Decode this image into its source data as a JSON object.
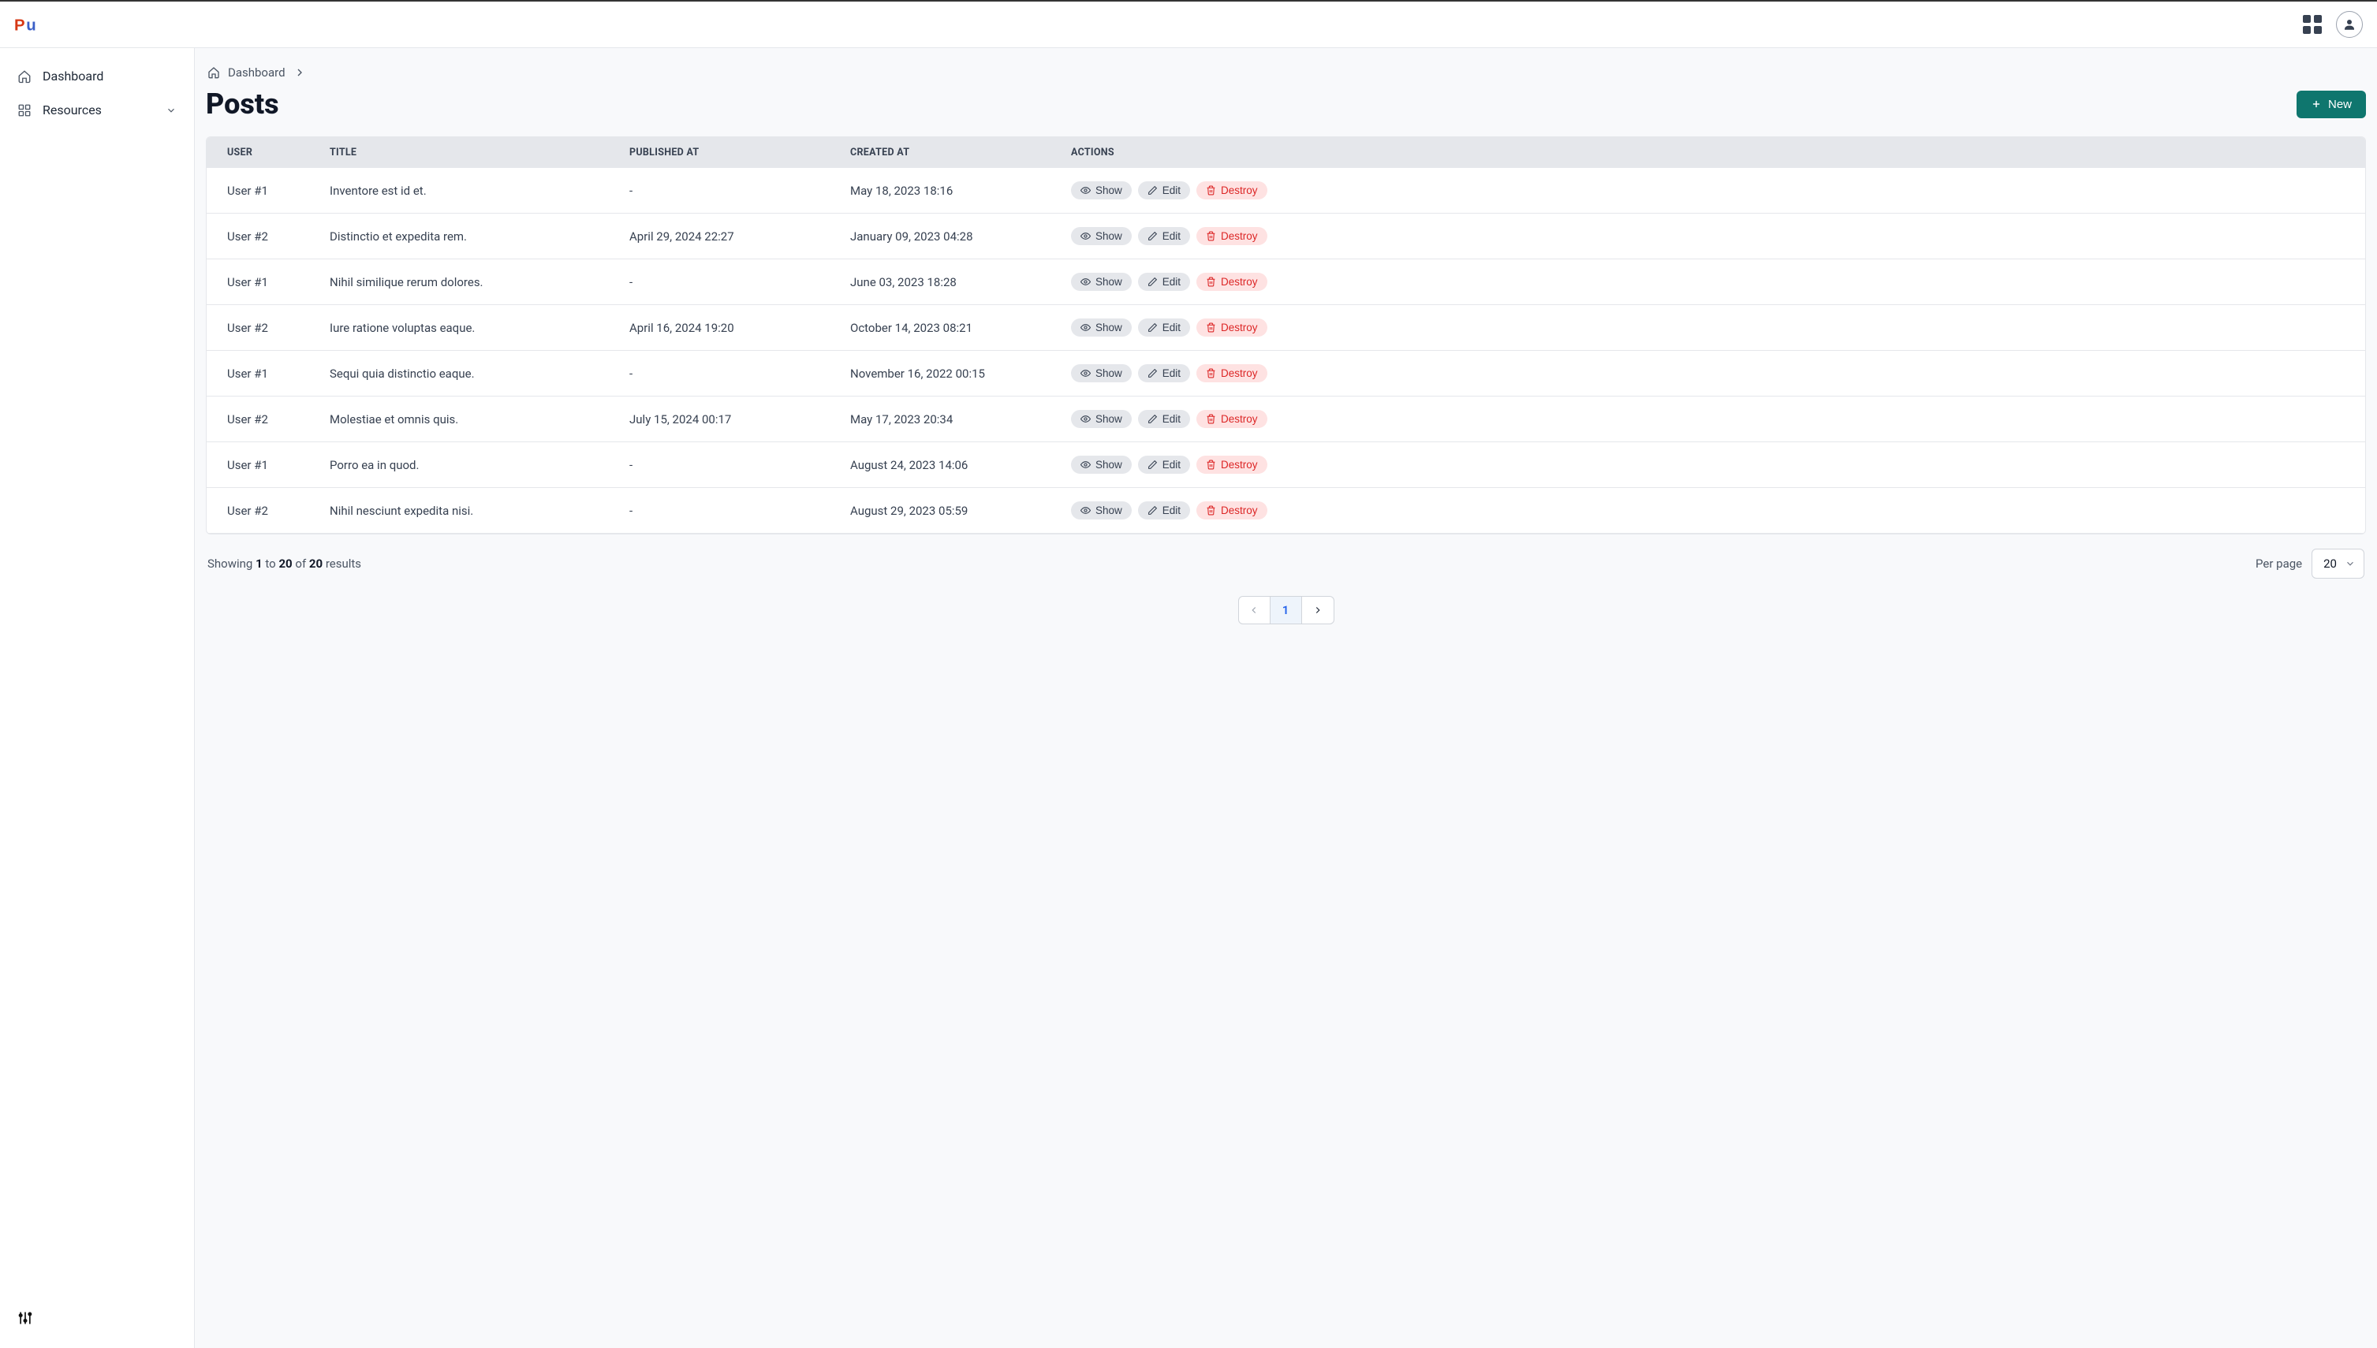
{
  "breadcrumb": {
    "home": "Dashboard"
  },
  "sidebar": {
    "items": [
      {
        "label": "Dashboard"
      },
      {
        "label": "Resources"
      }
    ]
  },
  "page": {
    "title": "Posts",
    "new_button": "New"
  },
  "table": {
    "columns": {
      "user": "USER",
      "title": "TITLE",
      "published_at": "PUBLISHED AT",
      "created_at": "CREATED AT",
      "actions": "ACTIONS"
    },
    "action_labels": {
      "show": "Show",
      "edit": "Edit",
      "destroy": "Destroy"
    },
    "rows": [
      {
        "user": "User #1",
        "title": "Inventore est id et.",
        "published_at": "-",
        "created_at": "May 18, 2023 18:16"
      },
      {
        "user": "User #2",
        "title": "Distinctio et expedita rem.",
        "published_at": "April 29, 2024 22:27",
        "created_at": "January 09, 2023 04:28"
      },
      {
        "user": "User #1",
        "title": "Nihil similique rerum dolores.",
        "published_at": "-",
        "created_at": "June 03, 2023 18:28"
      },
      {
        "user": "User #2",
        "title": "Iure ratione voluptas eaque.",
        "published_at": "April 16, 2024 19:20",
        "created_at": "October 14, 2023 08:21"
      },
      {
        "user": "User #1",
        "title": "Sequi quia distinctio eaque.",
        "published_at": "-",
        "created_at": "November 16, 2022 00:15"
      },
      {
        "user": "User #2",
        "title": "Molestiae et omnis quis.",
        "published_at": "July 15, 2024 00:17",
        "created_at": "May 17, 2023 20:34"
      },
      {
        "user": "User #1",
        "title": "Porro ea in quod.",
        "published_at": "-",
        "created_at": "August 24, 2023 14:06"
      },
      {
        "user": "User #2",
        "title": "Nihil nesciunt expedita nisi.",
        "published_at": "-",
        "created_at": "August 29, 2023 05:59"
      }
    ]
  },
  "footer": {
    "showing_prefix": "Showing ",
    "from": "1",
    "to_word": " to ",
    "to": "20",
    "of_word": " of ",
    "total": "20",
    "results_word": " results",
    "per_page_label": "Per page",
    "per_page_value": "20",
    "current_page": "1"
  }
}
